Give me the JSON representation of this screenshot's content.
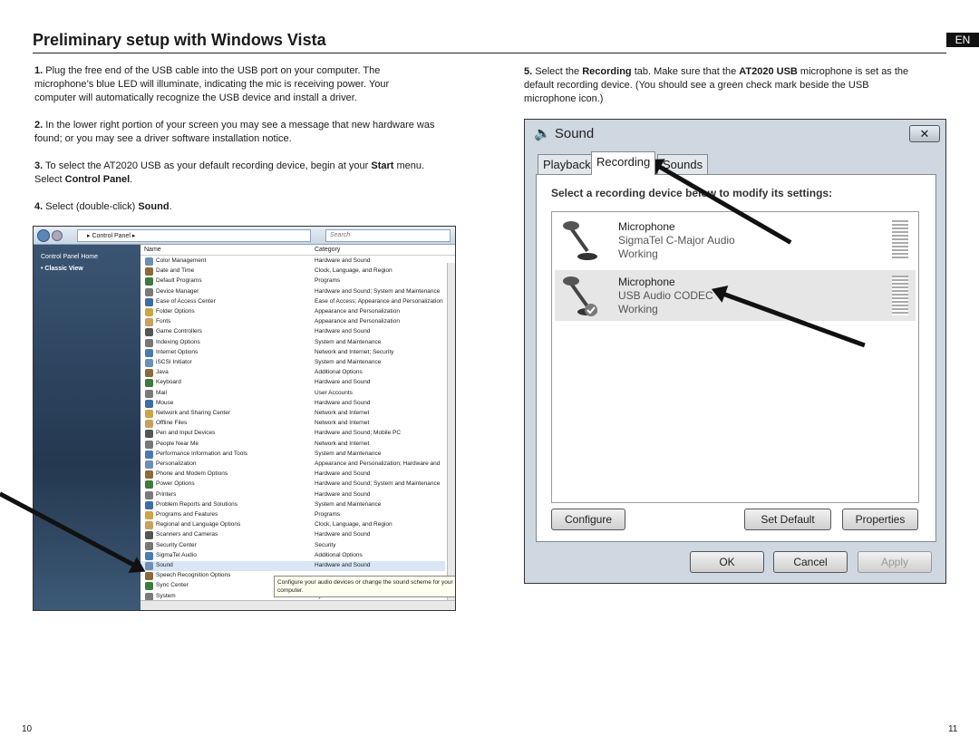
{
  "page": {
    "title": "Preliminary setup with Windows Vista",
    "lang_badge": "EN",
    "left_page_num": "10",
    "right_page_num": "11"
  },
  "steps": [
    {
      "num": "1.",
      "text": "Plug the free end of the USB cable into the USB port on your computer. The microphone’s blue LED will illuminate, indicating the mic is receiving power.  Your computer will automatically recognize the USB device and install a driver."
    },
    {
      "num": "2.",
      "text": "In the lower right portion of your screen you may see a message that new hardware was found; or you may see a driver software installation notice."
    },
    {
      "num": "3.",
      "pre": "To select the AT2020 USB as your default recording device, begin at your ",
      "b1": "Start",
      "mid": " menu. Select ",
      "b2": "Control Panel",
      "post": "."
    },
    {
      "num": "4.",
      "pre": "Select (double-click) ",
      "b1": "Sound",
      "post": "."
    },
    {
      "num": "5.",
      "pre": "Select the ",
      "b1": "Recording",
      "mid": " tab. Make sure that the ",
      "b2": "AT2020 USB",
      "post": " microphone is set as the default recording device. (You should see a green check mark beside the USB microphone icon.)"
    }
  ],
  "control_panel": {
    "address": "Control Panel",
    "search_placeholder": "Search",
    "sidebar": [
      "Control Panel Home",
      "Classic View"
    ],
    "col_name": "Name",
    "col_category": "Category",
    "rows": [
      [
        "Color Management",
        "Hardware and Sound"
      ],
      [
        "Date and Time",
        "Clock, Language, and Region"
      ],
      [
        "Default Programs",
        "Programs"
      ],
      [
        "Device Manager",
        "Hardware and Sound; System and Maintenance"
      ],
      [
        "Ease of Access Center",
        "Ease of Access; Appearance and Personalization"
      ],
      [
        "Folder Options",
        "Appearance and Personalization"
      ],
      [
        "Fonts",
        "Appearance and Personalization"
      ],
      [
        "Game Controllers",
        "Hardware and Sound"
      ],
      [
        "Indexing Options",
        "System and Maintenance"
      ],
      [
        "Internet Options",
        "Network and Internet; Security"
      ],
      [
        "iSCSI Initiator",
        "System and Maintenance"
      ],
      [
        "Java",
        "Additional Options"
      ],
      [
        "Keyboard",
        "Hardware and Sound"
      ],
      [
        "Mail",
        "User Accounts"
      ],
      [
        "Mouse",
        "Hardware and Sound"
      ],
      [
        "Network and Sharing Center",
        "Network and Internet"
      ],
      [
        "Offline Files",
        "Network and Internet"
      ],
      [
        "Pen and Input Devices",
        "Hardware and Sound; Mobile PC"
      ],
      [
        "People Near Me",
        "Network and Internet"
      ],
      [
        "Performance Information and Tools",
        "System and Maintenance"
      ],
      [
        "Personalization",
        "Appearance and Personalization; Hardware and"
      ],
      [
        "Phone and Modem Options",
        "Hardware and Sound"
      ],
      [
        "Power Options",
        "Hardware and Sound; System and Maintenance"
      ],
      [
        "Printers",
        "Hardware and Sound"
      ],
      [
        "Problem Reports and Solutions",
        "System and Maintenance"
      ],
      [
        "Programs and Features",
        "Programs"
      ],
      [
        "Regional and Language Options",
        "Clock, Language, and Region"
      ],
      [
        "Scanners and Cameras",
        "Hardware and Sound"
      ],
      [
        "Security Center",
        "Security"
      ],
      [
        "SigmaTel Audio",
        "Additional Options"
      ],
      [
        "Sound",
        "Hardware and Sound"
      ],
      [
        "Speech Recognition Options",
        ""
      ],
      [
        "Sync Center",
        ""
      ],
      [
        "System",
        "System and Maintenance"
      ]
    ],
    "tooltip": "Configure your audio devices or change the sound scheme for your computer."
  },
  "sound_dialog": {
    "title": "Sound",
    "close": "✕",
    "tabs": [
      "Playback",
      "Recording",
      "Sounds"
    ],
    "instruction": "Select a recording device below to modify its settings:",
    "devices": [
      {
        "name": "Microphone",
        "driver": "SigmaTel C-Major Audio",
        "status": "Working"
      },
      {
        "name": "Microphone",
        "driver": "USB Audio CODEC",
        "status": "Working"
      }
    ],
    "buttons": {
      "configure": "Configure",
      "set_default": "Set Default",
      "properties": "Properties",
      "ok": "OK",
      "cancel": "Cancel",
      "apply": "Apply"
    }
  }
}
